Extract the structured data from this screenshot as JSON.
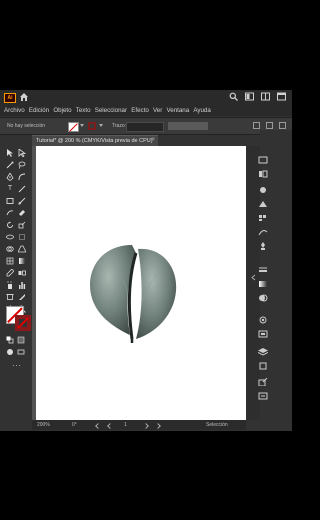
{
  "app": {
    "logo_text": "Ai",
    "menu": [
      "Archivo",
      "Edición",
      "Objeto",
      "Texto",
      "Seleccionar",
      "Efecto",
      "Ver",
      "Ventana",
      "Ayuda"
    ]
  },
  "controlbar": {
    "selection_label": "No hay selección",
    "stroke_label": "Trazo:"
  },
  "document_tab": {
    "title": "Tutorial* @ 200 % (CMYK/Vista previa de CPU)",
    "close": "×"
  },
  "statusbar": {
    "zoom": "200%",
    "rotation": "0°",
    "artboard_number": "1",
    "mode": "Selección"
  },
  "colors": {
    "accent_logo": "#ff9a00",
    "stroke_color": "#8a1a1a",
    "ui_background": "#323232"
  },
  "icons": [
    "home-icon",
    "search-icon",
    "arrange-icon",
    "workspace-icon",
    "window-icon"
  ]
}
